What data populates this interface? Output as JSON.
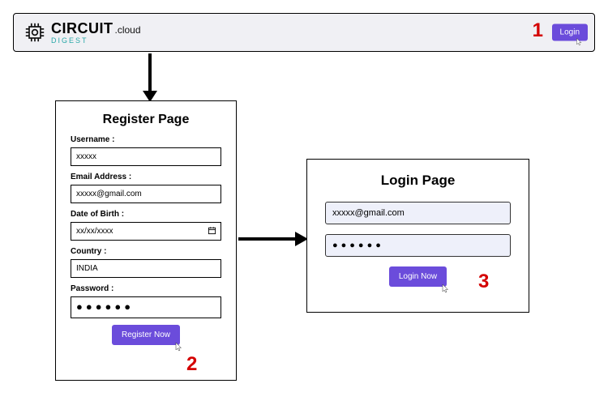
{
  "header": {
    "logo_main": "CIRCUIT",
    "logo_cloud": ".cloud",
    "logo_sub": "DIGEST",
    "login_label": "Login"
  },
  "steps": {
    "one": "1",
    "two": "2",
    "three": "3"
  },
  "register": {
    "title": "Register Page",
    "username_label": "Username :",
    "username_value": "xxxxx",
    "email_label": "Email Address :",
    "email_value": "xxxxx@gmail.com",
    "dob_label": "Date of Birth :",
    "dob_value": "xx/xx/xxxx",
    "country_label": "Country :",
    "country_value": "INDIA",
    "password_label": "Password :",
    "password_value": "●●●●●●",
    "submit_label": "Register Now"
  },
  "login": {
    "title": "Login Page",
    "email_value": "xxxxx@gmail.com",
    "password_value": "●●●●●●",
    "submit_label": "Login Now"
  }
}
